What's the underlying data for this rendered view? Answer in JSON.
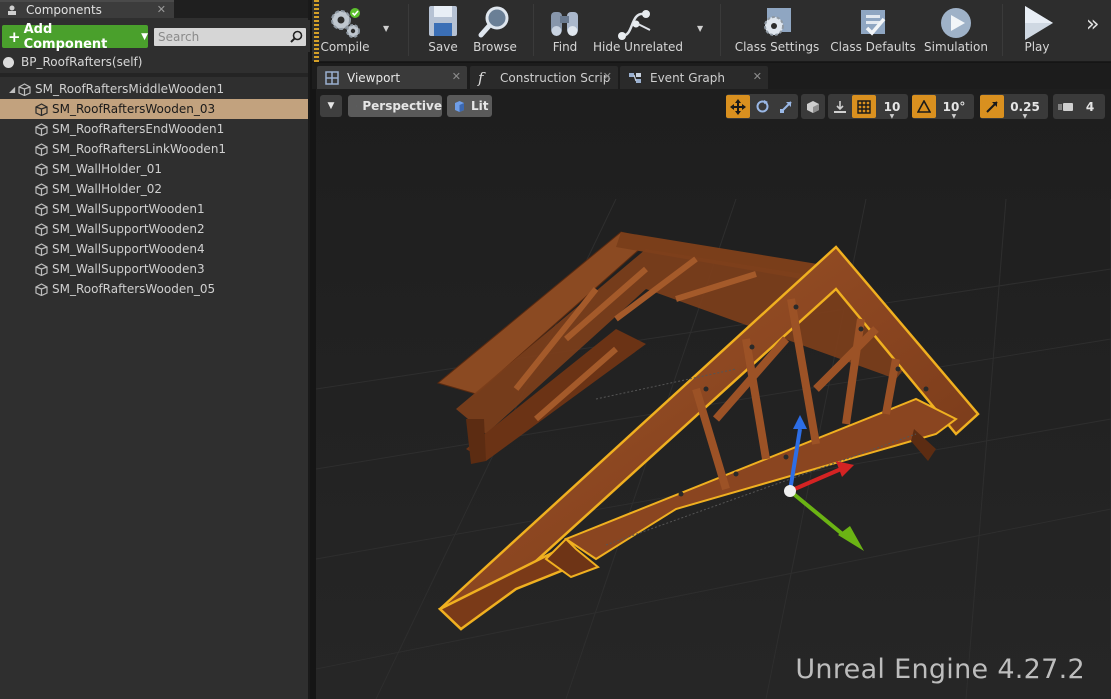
{
  "components_panel": {
    "tab_title": "Components",
    "tab_close": "✕",
    "add_component_label": "Add Component",
    "search_placeholder": "Search",
    "self_item": "BP_RoofRafters(self)",
    "tree": [
      {
        "label": "SM_RoofRaftersMiddleWooden1",
        "level": 0,
        "expandable": true,
        "selected": false
      },
      {
        "label": "SM_RoofRaftersWooden_03",
        "level": 1,
        "expandable": false,
        "selected": true
      },
      {
        "label": "SM_RoofRaftersEndWooden1",
        "level": 1,
        "expandable": false,
        "selected": false
      },
      {
        "label": "SM_RoofRaftersLinkWooden1",
        "level": 1,
        "expandable": false,
        "selected": false
      },
      {
        "label": "SM_WallHolder_01",
        "level": 1,
        "expandable": false,
        "selected": false
      },
      {
        "label": "SM_WallHolder_02",
        "level": 1,
        "expandable": false,
        "selected": false
      },
      {
        "label": "SM_WallSupportWooden1",
        "level": 1,
        "expandable": false,
        "selected": false
      },
      {
        "label": "SM_WallSupportWooden2",
        "level": 1,
        "expandable": false,
        "selected": false
      },
      {
        "label": "SM_WallSupportWooden4",
        "level": 1,
        "expandable": false,
        "selected": false
      },
      {
        "label": "SM_WallSupportWooden3",
        "level": 1,
        "expandable": false,
        "selected": false
      },
      {
        "label": "SM_RoofRaftersWooden_05",
        "level": 1,
        "expandable": false,
        "selected": false
      }
    ]
  },
  "toolbar": {
    "compile": "Compile",
    "save": "Save",
    "browse": "Browse",
    "find": "Find",
    "hide_unrelated": "Hide Unrelated",
    "class_settings": "Class Settings",
    "class_defaults": "Class Defaults",
    "simulation": "Simulation",
    "play": "Play",
    "overflow": "»"
  },
  "editor_tabs": [
    {
      "label": "Viewport",
      "close": "✕",
      "icon": "viewport-grid-icon"
    },
    {
      "label": "Construction Scrip",
      "close": "✕",
      "icon": "function-icon"
    },
    {
      "label": "Event Graph",
      "close": "✕",
      "icon": "event-graph-icon"
    }
  ],
  "viewport": {
    "view_mode": "Perspective",
    "lighting_mode": "Lit",
    "grid_snap": "10",
    "rotation_snap": "10°",
    "scale_snap": "0.25",
    "camera_speed": "4",
    "watermark": "Unreal Engine 4.27.2"
  },
  "colors": {
    "add_button": "#4aa02c",
    "selection": "#c2a27e",
    "accent_orange": "#d9901f",
    "wood": "#8a4a22",
    "outline": "#f0b020"
  }
}
